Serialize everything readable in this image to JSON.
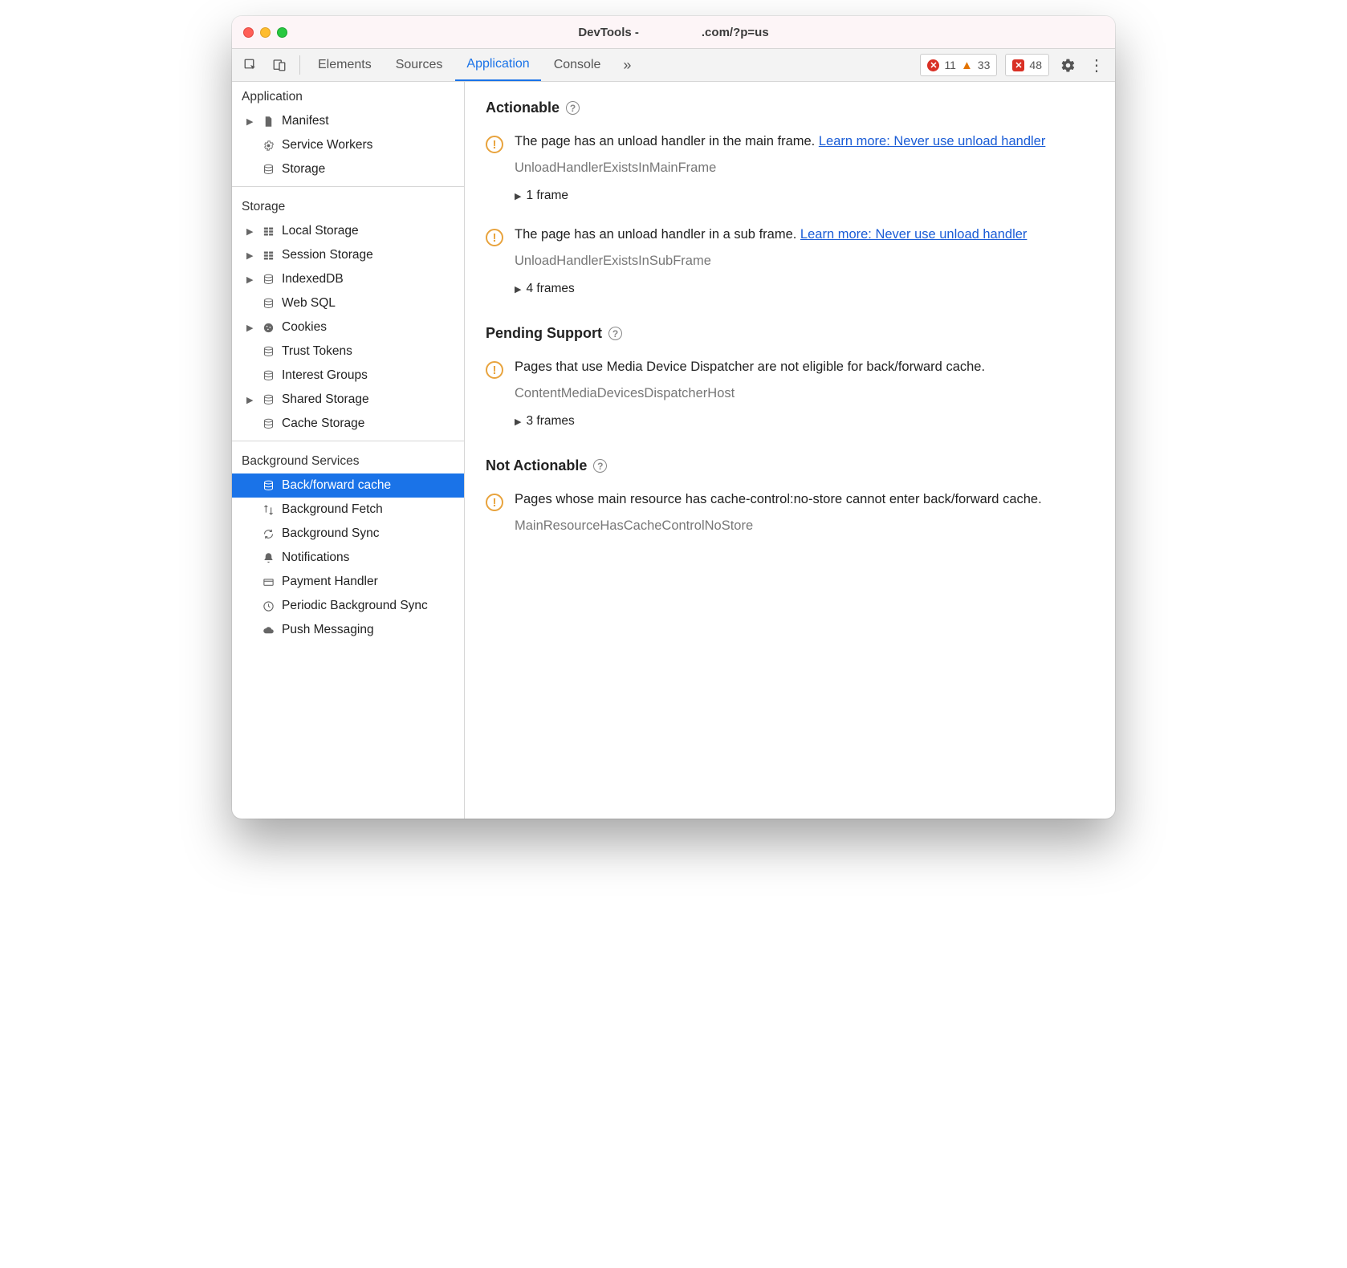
{
  "window": {
    "title_prefix": "DevTools -",
    "title_suffix": ".com/?p=us"
  },
  "toolbar": {
    "tabs": {
      "elements": "Elements",
      "sources": "Sources",
      "application": "Application",
      "console": "Console"
    },
    "errors_count": "11",
    "warnings_count": "33",
    "issues_count": "48"
  },
  "sidebar": {
    "sections": {
      "application": {
        "title": "Application",
        "items": {
          "manifest": "Manifest",
          "service_workers": "Service Workers",
          "storage": "Storage"
        }
      },
      "storage": {
        "title": "Storage",
        "items": {
          "local": "Local Storage",
          "session": "Session Storage",
          "indexeddb": "IndexedDB",
          "websql": "Web SQL",
          "cookies": "Cookies",
          "trust": "Trust Tokens",
          "interest": "Interest Groups",
          "shared": "Shared Storage",
          "cache": "Cache Storage"
        }
      },
      "background": {
        "title": "Background Services",
        "items": {
          "bfcache": "Back/forward cache",
          "bgfetch": "Background Fetch",
          "bgsync": "Background Sync",
          "notif": "Notifications",
          "payment": "Payment Handler",
          "periodic": "Periodic Background Sync",
          "push": "Push Messaging"
        }
      }
    }
  },
  "main": {
    "group_actionable": "Actionable",
    "group_pending": "Pending Support",
    "group_not_actionable": "Not Actionable",
    "issues": {
      "unload_main": {
        "msg": "The page has an unload handler in the main frame. ",
        "link": "Learn more: Never use unload handler",
        "code": "UnloadHandlerExistsInMainFrame",
        "frames": "1 frame"
      },
      "unload_sub": {
        "msg": "The page has an unload handler in a sub frame. ",
        "link": "Learn more: Never use unload handler",
        "code": "UnloadHandlerExistsInSubFrame",
        "frames": "4 frames"
      },
      "media": {
        "msg": "Pages that use Media Device Dispatcher are not eligible for back/forward cache.",
        "code": "ContentMediaDevicesDispatcherHost",
        "frames": "3 frames"
      },
      "nostore": {
        "msg": "Pages whose main resource has cache-control:no-store cannot enter back/forward cache.",
        "code": "MainResourceHasCacheControlNoStore"
      }
    }
  }
}
